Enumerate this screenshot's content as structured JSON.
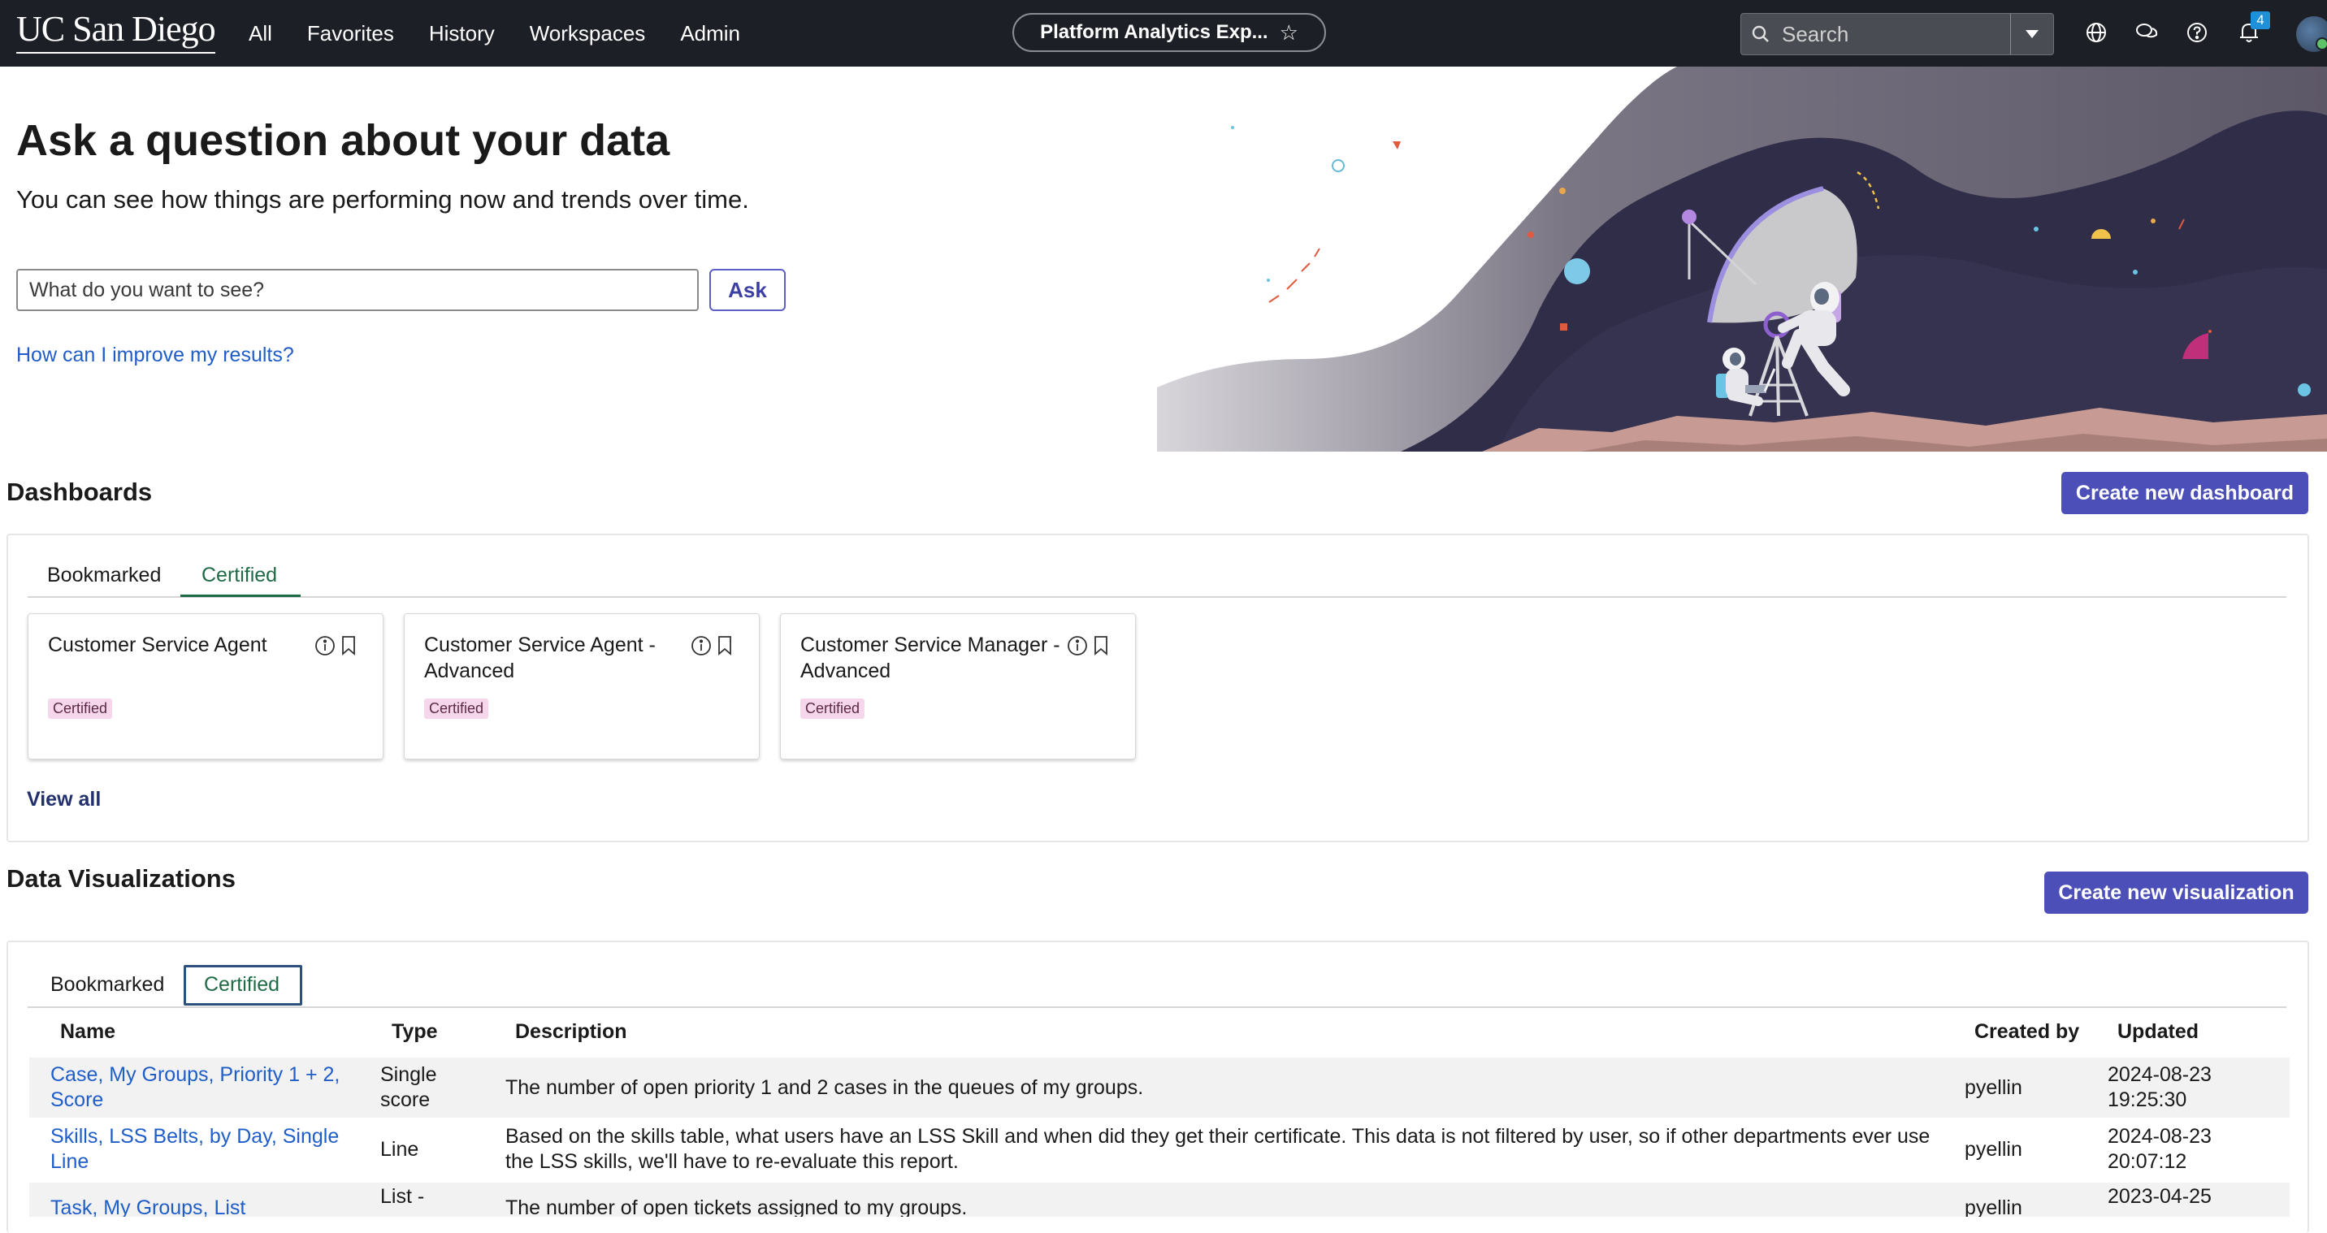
{
  "nav": {
    "logo": "UC San Diego",
    "links": [
      "All",
      "Favorites",
      "History",
      "Workspaces",
      "Admin"
    ],
    "workspace_pill": "Platform Analytics Exp...",
    "search_placeholder": "Search",
    "notification_count": "4"
  },
  "hero": {
    "title": "Ask a question about your data",
    "subtitle": "You can see how things are performing now and trends over time.",
    "input_placeholder": "What do you want to see?",
    "ask_label": "Ask",
    "improve_link": "How can I improve my results?"
  },
  "dashboards": {
    "title": "Dashboards",
    "create_label": "Create new dashboard",
    "tabs": [
      "Bookmarked",
      "Certified"
    ],
    "active_tab": "Certified",
    "cards": [
      {
        "title": "Customer Service Agent",
        "badge": "Certified"
      },
      {
        "title": "Customer Service Agent - Advanced",
        "badge": "Certified"
      },
      {
        "title": "Customer Service Manager - Advanced",
        "badge": "Certified"
      }
    ],
    "view_all": "View all"
  },
  "visualizations": {
    "title": "Data Visualizations",
    "create_label": "Create new visualization",
    "tabs": [
      "Bookmarked",
      "Certified"
    ],
    "active_tab": "Certified",
    "columns": [
      "Name",
      "Type",
      "Description",
      "Created by",
      "Updated"
    ],
    "rows": [
      {
        "name": "Case, My Groups, Priority 1 + 2, Score",
        "type": "Single score",
        "description": "The number of open priority 1 and 2 cases in the queues of my groups.",
        "created_by": "pyellin",
        "updated": "2024-08-23 19:25:30"
      },
      {
        "name": "Skills, LSS Belts, by Day, Single Line",
        "type": "Line",
        "description": "Based on the skills table, what users have an LSS Skill and when did they get their certificate. This data is not filtered by user, so if other departments ever use the LSS skills, we'll have to re-evaluate this report.",
        "created_by": "pyellin",
        "updated": "2024-08-23 20:07:12"
      },
      {
        "name": "Task, My Groups, List",
        "type": "List -",
        "description": "The number of open tickets assigned to my groups.",
        "created_by": "pyellin",
        "updated": "2023-04-25"
      }
    ]
  },
  "colors": {
    "nav_bg": "#1d1f26",
    "primary": "#4c4fb8",
    "link": "#1f5dc8",
    "active_tab": "#1e6b46",
    "certified_badge_bg": "#f6d6ea"
  }
}
